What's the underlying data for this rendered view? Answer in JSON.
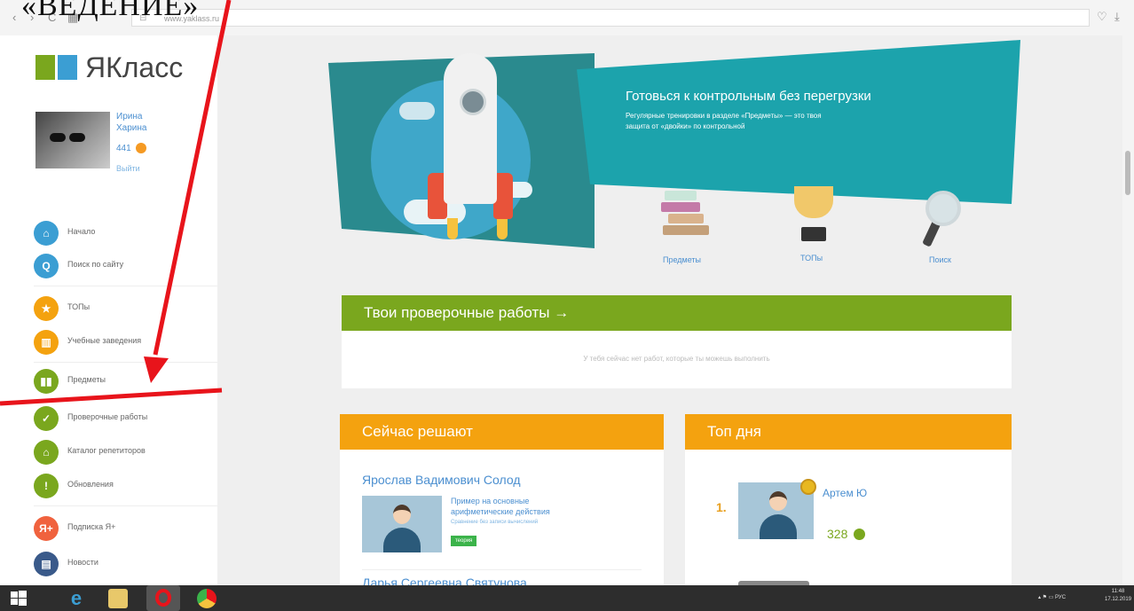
{
  "overlay_caption": "«ВЕДЕНИЕ»",
  "browser": {
    "back": "‹",
    "forward": "›",
    "reload": "C",
    "grid": "▦",
    "lock": "⊟",
    "url": "www.yaklass.ru"
  },
  "sidebar": {
    "logo": "ЯКласс",
    "user_first": "Ирина",
    "user_last": "Харина",
    "points": "441",
    "logout": "Выйти",
    "items": [
      {
        "label": "Начало",
        "color": "#3b9ed3",
        "icon": "home-icon",
        "glyph": "⌂"
      },
      {
        "label": "Поиск по сайту",
        "color": "#3b9ed3",
        "icon": "search-icon",
        "glyph": "Q"
      },
      {
        "label": "ТОПы",
        "color": "#f4a20f",
        "icon": "star-icon",
        "glyph": "★"
      },
      {
        "label": "Учебные заведения",
        "color": "#f4a20f",
        "icon": "school-icon",
        "glyph": "▥"
      },
      {
        "label": "Предметы",
        "color": "#7aa71e",
        "icon": "books-icon",
        "glyph": "▮▮"
      },
      {
        "label": "Проверочные работы",
        "color": "#7aa71e",
        "icon": "check-icon",
        "glyph": "✓"
      },
      {
        "label": "Каталог репетиторов",
        "color": "#7aa71e",
        "icon": "graduation-cap-icon",
        "glyph": "⌂"
      },
      {
        "label": "Обновления",
        "color": "#7aa71e",
        "icon": "exclamation-icon",
        "glyph": "!"
      },
      {
        "label": "Подписка Я+",
        "color": "#f0623e",
        "icon": "subscription-icon",
        "glyph": "Я+"
      },
      {
        "label": "Новости",
        "color": "#3a5a8a",
        "icon": "news-icon",
        "glyph": "▤"
      }
    ]
  },
  "banner": {
    "title": "Готовься к контрольным без перегрузки",
    "subtitle_line1": "Регулярные тренировки в разделе «Предметы» — это твоя",
    "subtitle_line2": "защита от «двойки» по контрольной",
    "links": [
      "Предметы",
      "ТОПы",
      "Поиск"
    ]
  },
  "tests_card": {
    "title": "Твои проверочные работы →",
    "empty_text": "У тебя сейчас нет работ, которые ты можешь выполнить"
  },
  "solving_card": {
    "title": "Сейчас решают",
    "solver1": "Ярослав Вадимович Солод",
    "task_line1": "Пример на основные",
    "task_line2": "арифметические действия",
    "task_sub": "Сравнение без записи вычислений",
    "task_badge": "теория",
    "solver2": "Дарья Сергеевна Святунова"
  },
  "top_card": {
    "title": "Топ дня",
    "rank": "1.",
    "user": "Артем Ю",
    "points": "328"
  },
  "taskbar": {
    "tray": "▴ ⚑ ▭ РУС",
    "time": "11:48",
    "date": "17.12.2019"
  }
}
